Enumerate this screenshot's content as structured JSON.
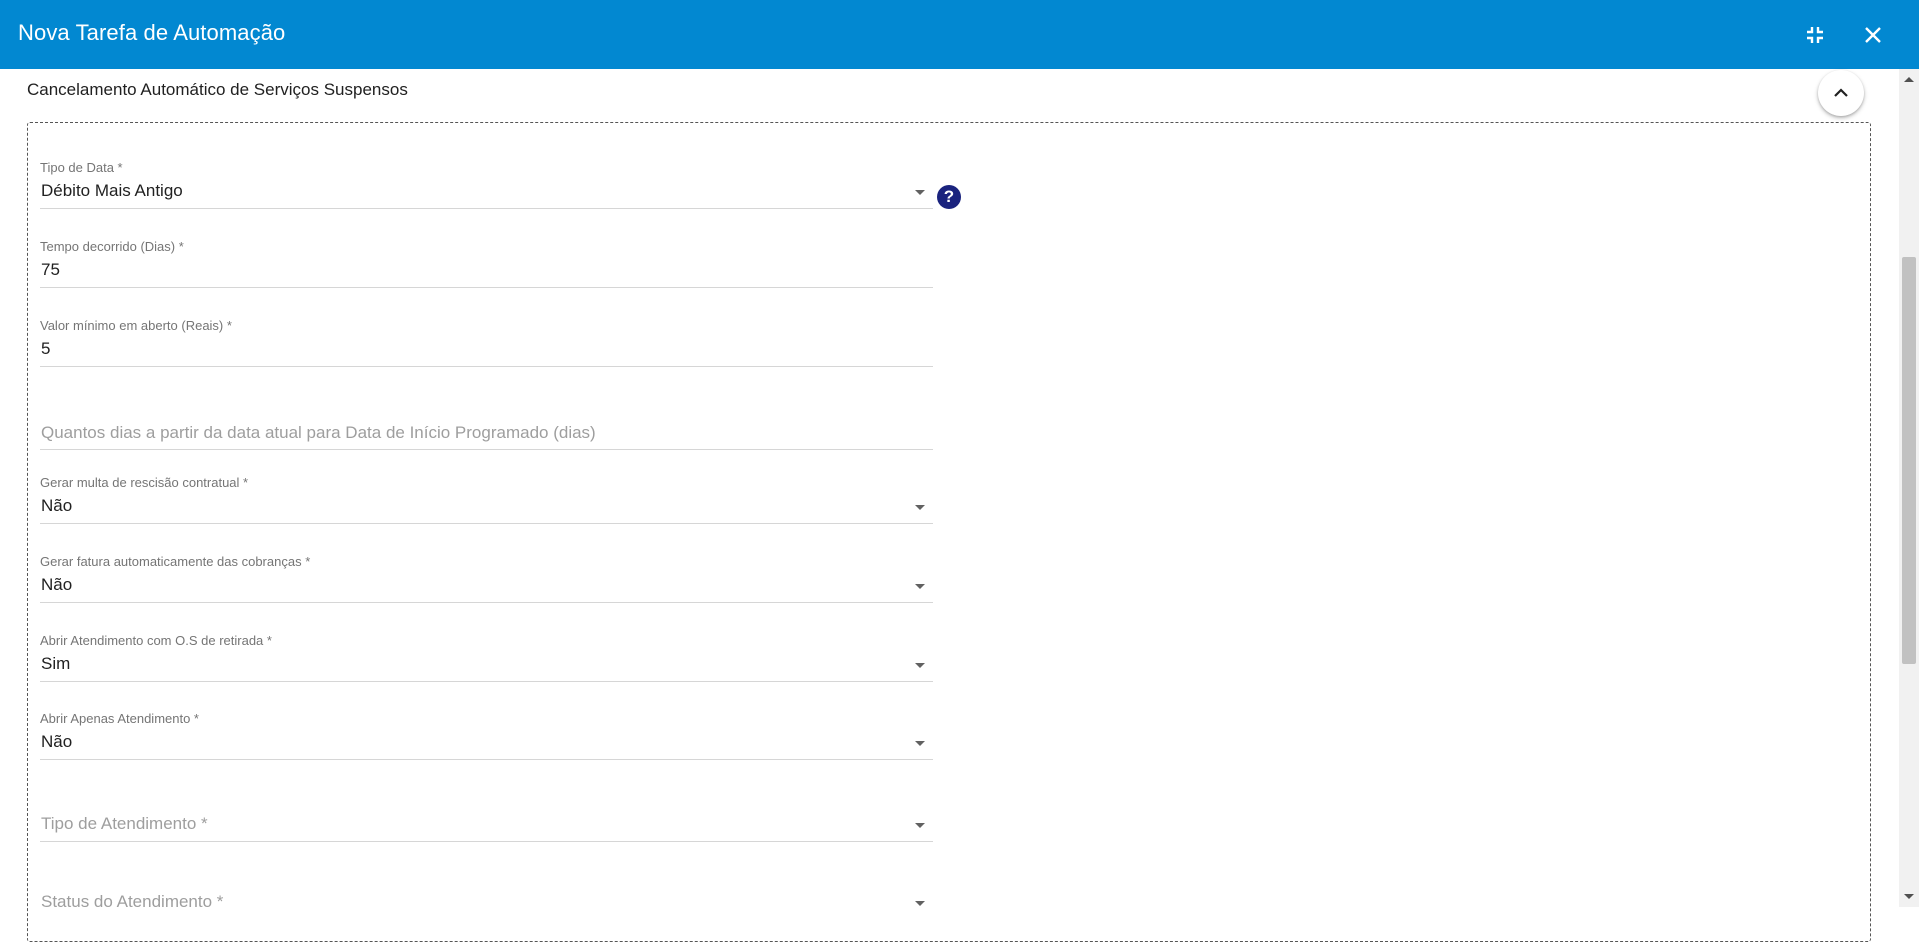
{
  "dialog": {
    "title": "Nova Tarefa de Automação",
    "minimize_icon": "fullscreen-exit-icon",
    "close_icon": "close-icon",
    "header_color": "#0288d1"
  },
  "section": {
    "title": "Cancelamento Automático de Serviços Suspensos",
    "collapse_icon": "chevron-up-icon"
  },
  "fields": {
    "tipo_data": {
      "label": "Tipo de Data *",
      "value": "Débito Mais Antigo",
      "help_icon": "?"
    },
    "tempo_decorrido": {
      "label": "Tempo decorrido (Dias) *",
      "value": "75"
    },
    "valor_minimo": {
      "label": "Valor mínimo em aberto (Reais) *",
      "value": "5"
    },
    "dias_inicio": {
      "placeholder": "Quantos dias a partir da data atual para Data de Início Programado (dias)"
    },
    "multa_rescisao": {
      "label": "Gerar multa de rescisão contratual *",
      "value": "Não"
    },
    "fatura_auto": {
      "label": "Gerar fatura automaticamente das cobranças *",
      "value": "Não"
    },
    "atendimento_os": {
      "label": "Abrir Atendimento com O.S de retirada *",
      "value": "Sim"
    },
    "apenas_atendimento": {
      "label": "Abrir Apenas Atendimento *",
      "value": "Não"
    },
    "tipo_atendimento": {
      "placeholder": "Tipo de Atendimento *"
    },
    "status_atendimento": {
      "placeholder": "Status do Atendimento *"
    }
  }
}
